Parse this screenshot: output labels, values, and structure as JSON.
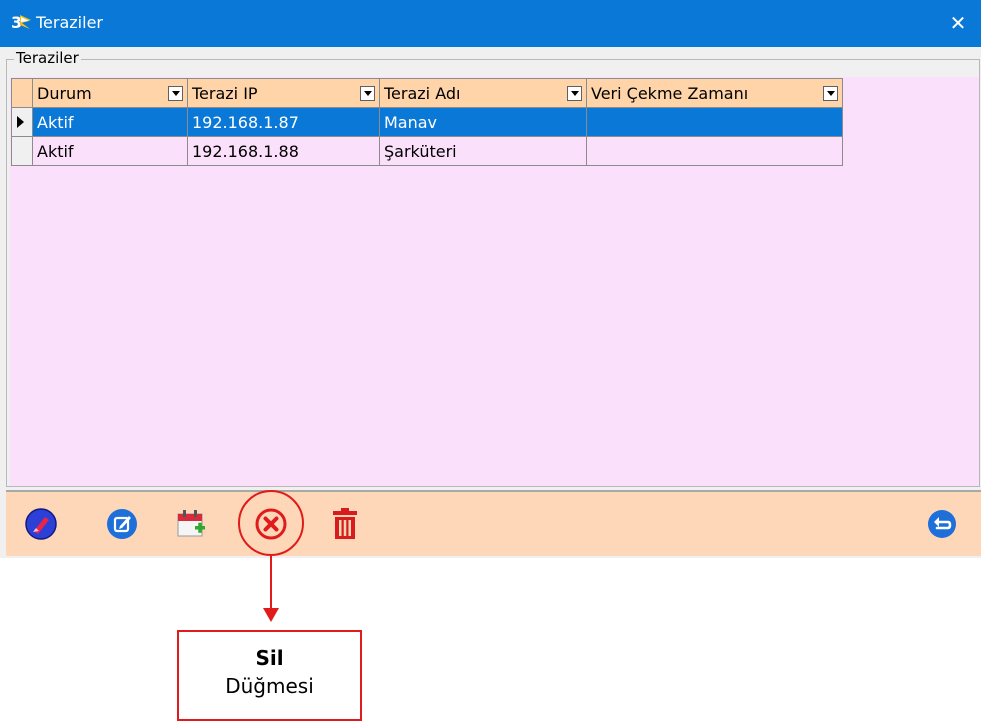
{
  "window": {
    "title": "Teraziler",
    "close_glyph": "✕",
    "app_icon": "app-logo-icon"
  },
  "group": {
    "label": "Teraziler"
  },
  "grid": {
    "columns": [
      "Durum",
      "Terazi IP",
      "Terazi Adı",
      "Veri Çekme Zamanı"
    ],
    "rows": [
      {
        "durum": "Aktif",
        "ip": "192.168.1.87",
        "ad": "Manav",
        "zaman": "",
        "selected": true
      },
      {
        "durum": "Aktif",
        "ip": "192.168.1.88",
        "ad": "Şarküteri",
        "zaman": "",
        "selected": false
      }
    ]
  },
  "toolbar": {
    "buttons": [
      {
        "icon": "clean-icon"
      },
      {
        "icon": "edit-icon"
      },
      {
        "icon": "add-calendar-icon"
      },
      {
        "icon": "delete-circle-icon"
      },
      {
        "icon": "trash-icon"
      },
      {
        "icon": "return-icon"
      }
    ]
  },
  "callout": {
    "title": "Sil",
    "subtitle": "Düğmesi",
    "color": "#e01b1b"
  },
  "colors": {
    "title_bar": "#0a78d6",
    "grid_bg": "#fae0fa",
    "header_bg": "#ffd4a8",
    "toolbar_bg": "#fdd7b8",
    "selection": "#0a78d6"
  }
}
